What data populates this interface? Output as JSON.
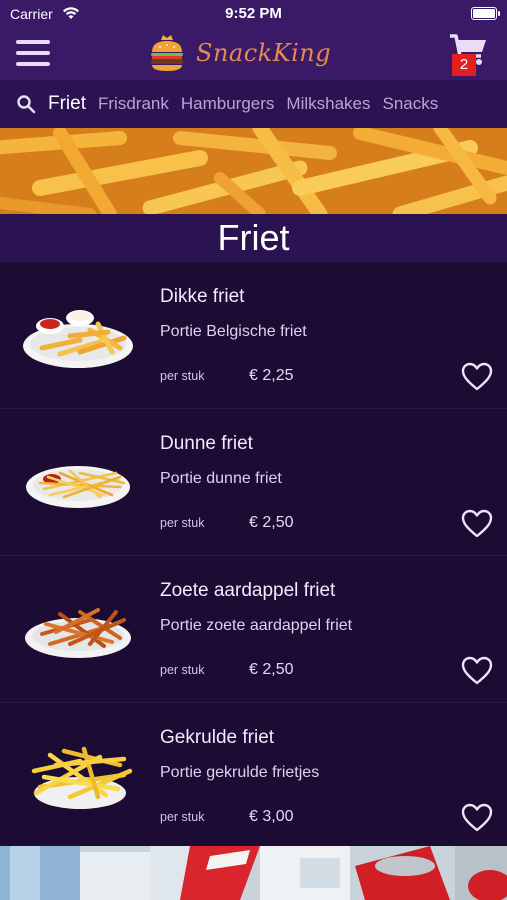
{
  "status_bar": {
    "carrier": "Carrier",
    "time": "9:52 PM"
  },
  "header": {
    "brand": "SnackKing",
    "cart_count": "2"
  },
  "categories": [
    {
      "label": "Friet",
      "active": true
    },
    {
      "label": "Frisdrank",
      "active": false
    },
    {
      "label": "Hamburgers",
      "active": false
    },
    {
      "label": "Milkshakes",
      "active": false
    },
    {
      "label": "Snacks",
      "active": false
    }
  ],
  "section": {
    "title": "Friet"
  },
  "products": [
    {
      "name": "Dikke friet",
      "description": "Portie Belgische friet",
      "unit": "per stuk",
      "price": "€ 2,25"
    },
    {
      "name": "Dunne friet",
      "description": "Portie dunne friet",
      "unit": "per stuk",
      "price": "€ 2,50"
    },
    {
      "name": "Zoete aardappel friet",
      "description": "Portie zoete aardappel friet",
      "unit": "per stuk",
      "price": "€ 2,50"
    },
    {
      "name": "Gekrulde friet",
      "description": "Portie gekrulde frietjes",
      "unit": "per stuk",
      "price": "€ 3,00"
    }
  ],
  "icons": {
    "menu": "hamburger-menu-icon",
    "cart": "cart-icon",
    "search": "search-icon",
    "favorite": "heart-icon"
  },
  "colors": {
    "header_bg": "#3a1a66",
    "content_bg": "#1c0b33",
    "brand_accent": "#e58a4e",
    "badge": "#e22020"
  }
}
